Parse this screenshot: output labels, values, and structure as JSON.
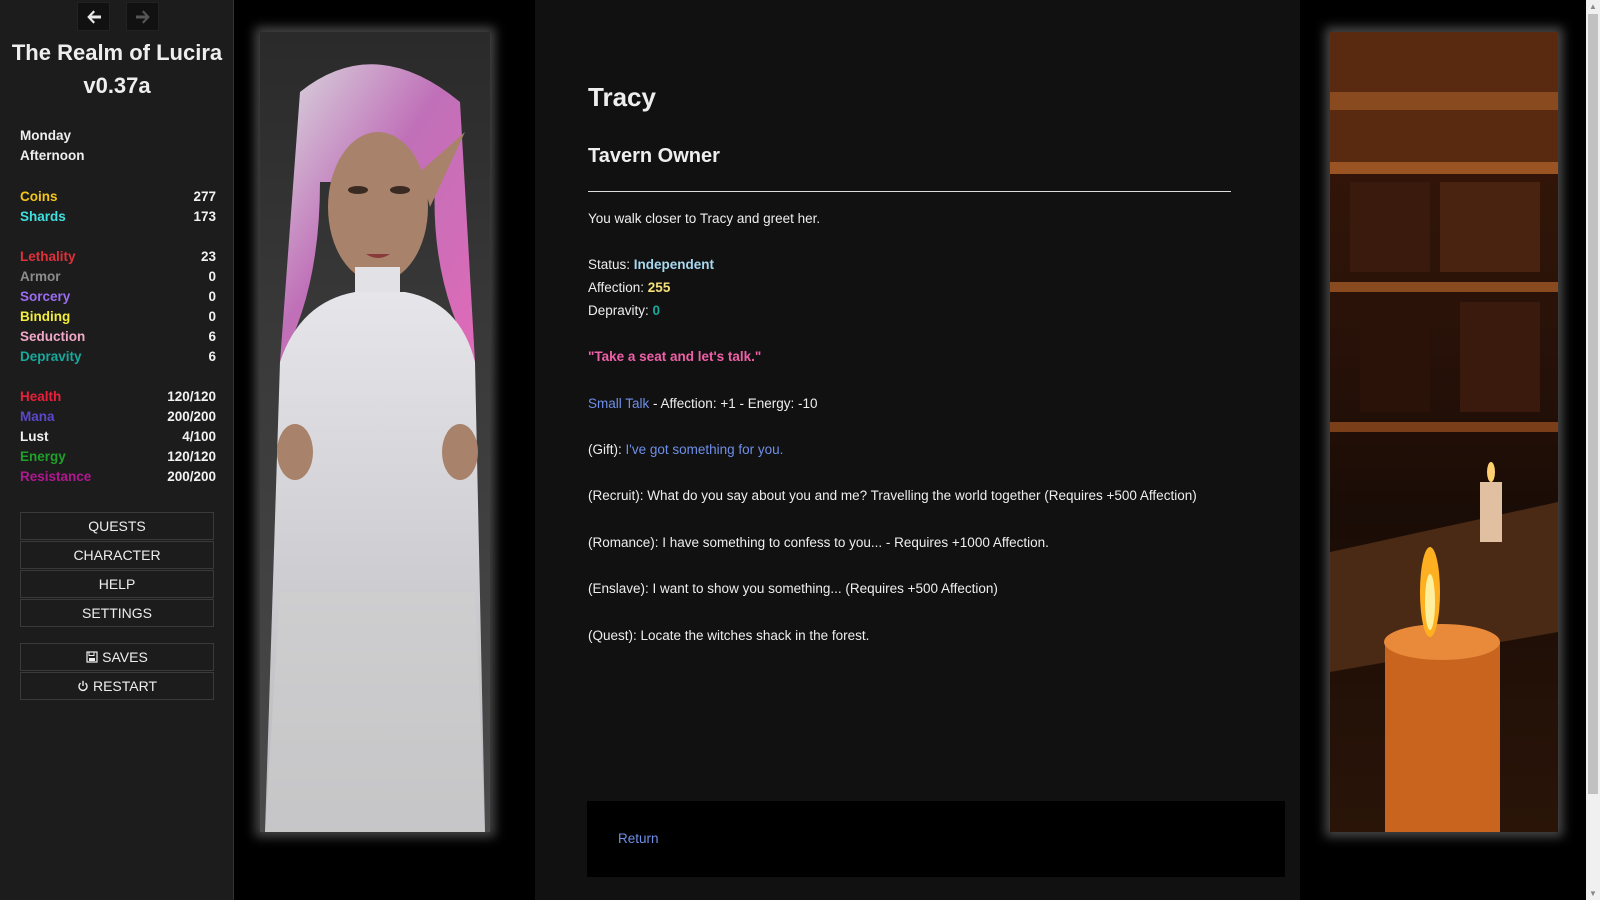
{
  "sidebar": {
    "title": "The Realm of Lucira v0.37a",
    "day": "Monday",
    "time": "Afternoon",
    "currency": [
      {
        "label": "Coins",
        "value": "277",
        "color": "#f5c518"
      },
      {
        "label": "Shards",
        "value": "173",
        "color": "#3fe0e0"
      }
    ],
    "attributes": [
      {
        "label": "Lethality",
        "value": "23",
        "color": "#e0303a"
      },
      {
        "label": "Armor",
        "value": "0",
        "color": "#8c8c8c"
      },
      {
        "label": "Sorcery",
        "value": "0",
        "color": "#9b6cf0"
      },
      {
        "label": "Binding",
        "value": "0",
        "color": "#f2ee3a"
      },
      {
        "label": "Seduction",
        "value": "6",
        "color": "#f2a8c8"
      },
      {
        "label": "Depravity",
        "value": "6",
        "color": "#18a89c"
      }
    ],
    "vitals": [
      {
        "label": "Health",
        "value": "120/120",
        "color": "#e8203a"
      },
      {
        "label": "Mana",
        "value": "200/200",
        "color": "#5a48c8"
      },
      {
        "label": "Lust",
        "value": "4/100",
        "color": "#f2f2f2"
      },
      {
        "label": "Energy",
        "value": "120/120",
        "color": "#1ea02a"
      },
      {
        "label": "Resistance",
        "value": "200/200",
        "color": "#b01890"
      }
    ],
    "menu": [
      {
        "name": "quests-button",
        "label": "QUESTS"
      },
      {
        "name": "character-button",
        "label": "CHARACTER"
      },
      {
        "name": "help-button",
        "label": "HELP"
      },
      {
        "name": "settings-button",
        "label": "SETTINGS"
      }
    ],
    "saves_label": "SAVES",
    "restart_label": "RESTART"
  },
  "passage": {
    "name": "Tracy",
    "role": "Tavern Owner",
    "intro": "You walk closer to Tracy and greet her.",
    "status_label": "Status: ",
    "status_value": "Independent",
    "affection_label": "Affection: ",
    "affection_value": "255",
    "depravity_label": "Depravity: ",
    "depravity_value": "0",
    "quote": "\"Take a seat and let's talk.\"",
    "small_talk_link": "Small Talk",
    "small_talk_desc": " - Affection: +1 - Energy: -10",
    "gift_prefix": "(Gift): ",
    "gift_link": "I've got something for you.",
    "recruit": "(Recruit): What do you say about you and me? Travelling the world together (Requires +500 Affection)",
    "romance": "(Romance): I have something to confess to you... - Requires +1000 Affection.",
    "enslave": "(Enslave): I want to show you something... (Requires +500 Affection)",
    "quest": "(Quest): Locate the witches shack in the forest.",
    "return_link": "Return"
  },
  "colors": {
    "status_value": "#a8d8f0",
    "affection_value": "#f5e07a",
    "depravity_value": "#18a89c",
    "quote": "#f060a8",
    "link": "#6f8fe8"
  },
  "icons": {
    "back": "arrow-left-icon",
    "forward": "arrow-right-icon",
    "saves": "floppy-disk-icon",
    "restart": "power-icon"
  }
}
